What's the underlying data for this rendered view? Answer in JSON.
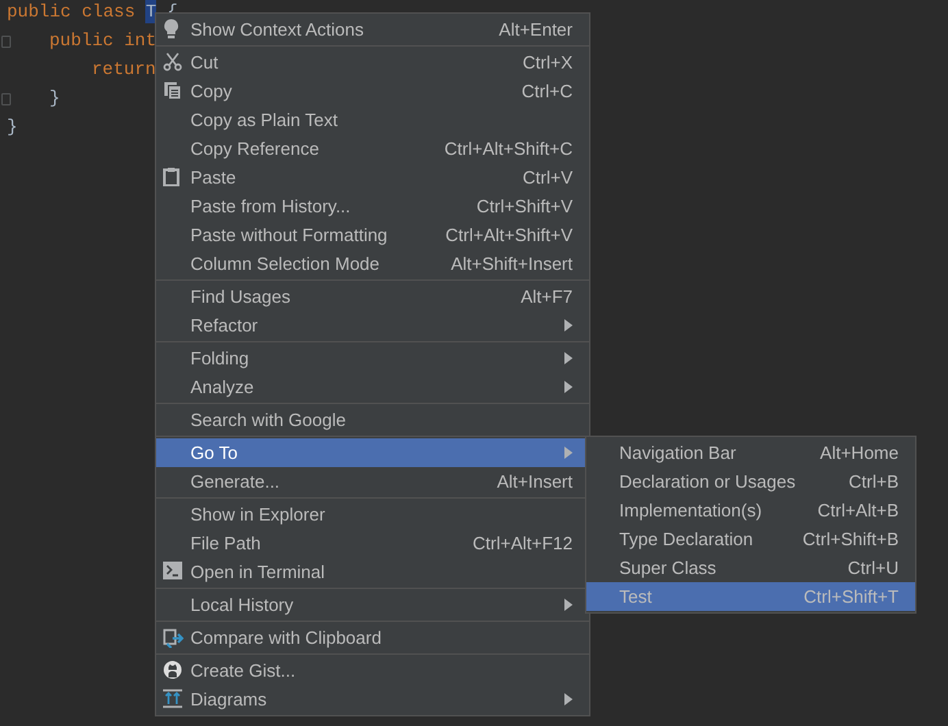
{
  "editor": {
    "lines": [
      {
        "fold_marker": false,
        "tokens": [
          {
            "text": "public class ",
            "kind": "keyword"
          },
          {
            "text": "T",
            "kind": "selection"
          },
          {
            "text": " {",
            "kind": "plain"
          }
        ],
        "children": [
          {
            "fold_marker": true,
            "tokens": [
              {
                "text": "public int",
                "kind": "keyword"
              }
            ],
            "children": [
              {
                "fold_marker": false,
                "tokens": [
                  {
                    "text": "return",
                    "kind": "keyword"
                  }
                ]
              }
            ]
          },
          {
            "fold_marker": true,
            "tokens": [
              {
                "text": "}",
                "kind": "plain"
              }
            ]
          }
        ]
      },
      {
        "fold_marker": false,
        "tokens": [
          {
            "text": "}",
            "kind": "plain"
          }
        ]
      }
    ]
  },
  "context_menu": {
    "groups": [
      [
        {
          "label": "Show Context Actions",
          "shortcut": "Alt+Enter",
          "submenu": false,
          "selected": false
        }
      ],
      [
        {
          "label": "Cut",
          "shortcut": "Ctrl+X",
          "submenu": false,
          "selected": false
        },
        {
          "label": "Copy",
          "shortcut": "Ctrl+C",
          "submenu": false,
          "selected": false
        },
        {
          "label": "Copy as Plain Text",
          "submenu": false,
          "selected": false
        },
        {
          "label": "Copy Reference",
          "shortcut": "Ctrl+Alt+Shift+C",
          "submenu": false,
          "selected": false
        },
        {
          "label": "Paste",
          "shortcut": "Ctrl+V",
          "submenu": false,
          "selected": false
        },
        {
          "label": "Paste from History...",
          "shortcut": "Ctrl+Shift+V",
          "submenu": false,
          "selected": false
        },
        {
          "label": "Paste without Formatting",
          "shortcut": "Ctrl+Alt+Shift+V",
          "submenu": false,
          "selected": false
        },
        {
          "label": "Column Selection Mode",
          "shortcut": "Alt+Shift+Insert",
          "submenu": false,
          "selected": false
        }
      ],
      [
        {
          "label": "Find Usages",
          "shortcut": "Alt+F7",
          "submenu": false,
          "selected": false
        },
        {
          "label": "Refactor",
          "submenu": true,
          "selected": false
        }
      ],
      [
        {
          "label": "Folding",
          "submenu": true,
          "selected": false
        },
        {
          "label": "Analyze",
          "submenu": true,
          "selected": false
        }
      ],
      [
        {
          "label": "Search with Google",
          "submenu": false,
          "selected": false
        }
      ],
      [
        {
          "label": "Go To",
          "submenu": true,
          "selected": true
        },
        {
          "label": "Generate...",
          "shortcut": "Alt+Insert",
          "submenu": false,
          "selected": false
        }
      ],
      [
        {
          "label": "Show in Explorer",
          "submenu": false,
          "selected": false
        },
        {
          "label": "File Path",
          "shortcut": "Ctrl+Alt+F12",
          "submenu": false,
          "selected": false
        },
        {
          "label": "Open in Terminal",
          "submenu": false,
          "selected": false
        }
      ],
      [
        {
          "label": "Local History",
          "submenu": true,
          "selected": false
        }
      ],
      [
        {
          "label": "Compare with Clipboard",
          "submenu": false,
          "selected": false
        }
      ],
      [
        {
          "label": "Create Gist...",
          "submenu": false,
          "selected": false
        },
        {
          "label": "Diagrams",
          "submenu": true,
          "selected": false
        }
      ]
    ]
  },
  "go_to_submenu": {
    "items": [
      {
        "label": "Navigation Bar",
        "shortcut": "Alt+Home",
        "selected": false
      },
      {
        "label": "Declaration or Usages",
        "shortcut": "Ctrl+B",
        "selected": false
      },
      {
        "label": "Implementation(s)",
        "shortcut": "Ctrl+Alt+B",
        "selected": false
      },
      {
        "label": "Type Declaration",
        "shortcut": "Ctrl+Shift+B",
        "selected": false
      },
      {
        "label": "Super Class",
        "shortcut": "Ctrl+U",
        "selected": false
      },
      {
        "label": "Test",
        "shortcut": "Ctrl+Shift+T",
        "selected": true
      }
    ]
  }
}
